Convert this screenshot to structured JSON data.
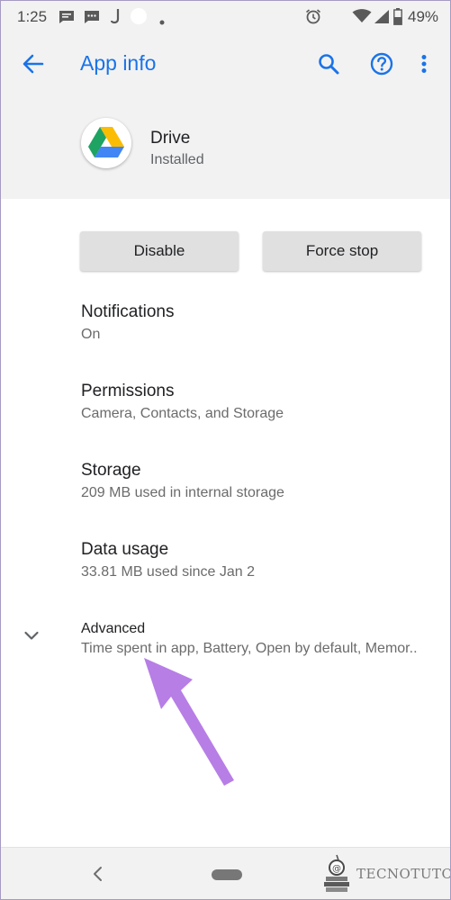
{
  "status_bar": {
    "time": "1:25",
    "battery": "49%",
    "icons": [
      "message-icon",
      "chat-icon",
      "j-icon",
      "circle-icon",
      "dot-icon",
      "alarm-icon",
      "wifi-icon",
      "signal-icon",
      "battery-icon"
    ]
  },
  "app_bar": {
    "title": "App info",
    "icons": [
      "back-arrow-icon",
      "search-icon",
      "help-icon",
      "more-vert-icon"
    ],
    "accent_color": "#1a73e8"
  },
  "app": {
    "name": "Drive",
    "state": "Installed",
    "icon": "google-drive-icon"
  },
  "actions": {
    "disable_label": "Disable",
    "force_stop_label": "Force stop"
  },
  "preferences": [
    {
      "title": "Notifications",
      "summary": "On"
    },
    {
      "title": "Permissions",
      "summary": "Camera, Contacts, and Storage"
    },
    {
      "title": "Storage",
      "summary": "209 MB used in internal storage"
    },
    {
      "title": "Data usage",
      "summary": "33.81 MB used since Jan 2"
    }
  ],
  "advanced": {
    "title": "Advanced",
    "summary": "Time spent in app, Battery, Open by default, Memor..",
    "icon": "chevron-down-icon"
  },
  "annotation": {
    "icon": "purple-arrow-annotation",
    "color": "#b77ee6"
  },
  "nav_bar": {
    "icons": [
      "nav-back-icon",
      "nav-home-pill"
    ]
  },
  "watermark": {
    "text": "TECNOTUTO",
    "icon": "tecnotuto-logo-icon"
  }
}
